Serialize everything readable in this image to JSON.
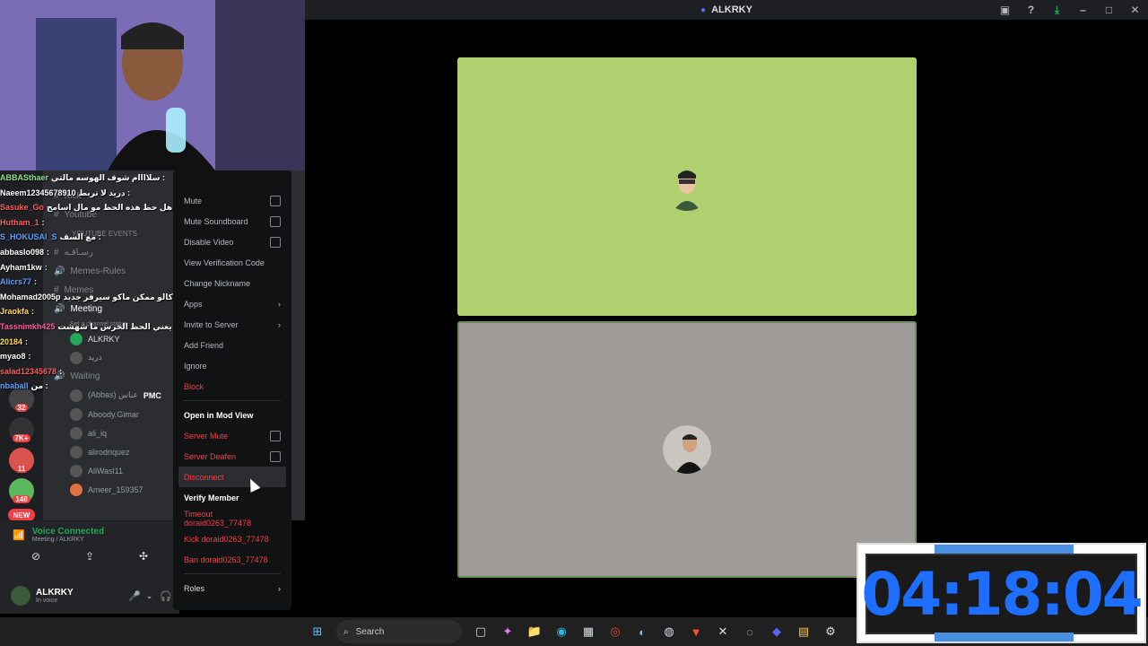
{
  "window": {
    "title": "ALKRKY"
  },
  "stage": {
    "tile_colors": [
      "#b0cf6f",
      "#9e9b98"
    ]
  },
  "chat": [
    {
      "user": "ABBASthaer",
      "text": "سلاااام شوف الهوسه مالتي :",
      "color": "#8be28b"
    },
    {
      "user": "Naeem12345678910",
      "text": "دريد لا تربط :",
      "color": "#ffffff"
    },
    {
      "user": "Sasuke_Go",
      "text": "ليش هل حظ هذه الحظ مو مال اسامح :",
      "color": "#ff5a5a"
    },
    {
      "user": "Hutham_1",
      "text": ":",
      "color": "#ff5a5a"
    },
    {
      "user": "S_HOKUSAI_S",
      "text": "مع السف :",
      "color": "#5aa0ff"
    },
    {
      "user": "abbaslo098",
      "text": ":",
      "color": "#ffffff"
    },
    {
      "user": "Ayham1kw",
      "text": ":",
      "color": "#ffffff"
    },
    {
      "user": "Alicrs77",
      "text": ":",
      "color": "#5aa0ff"
    },
    {
      "user": "Mohamad2005p",
      "text": "مو كم مرة كالو ممكن ماكو سيرفر جديد :",
      "color": "#ffffff"
    },
    {
      "user": "Jraokfa",
      "text": ":",
      "color": "#ffd75a"
    },
    {
      "user": "Tassnimkh425",
      "text": "كيف يعني الحظ الخرس ما شهشت :",
      "color": "#ff5aa5"
    },
    {
      "user": "20184",
      "text": ":",
      "color": "#ffd75a"
    },
    {
      "user": "myao8",
      "text": ":",
      "color": "#ffffff"
    },
    {
      "user": "salad12345678",
      "text": ":",
      "color": "#ff5a5a"
    },
    {
      "user": "nbaball",
      "text": "من :",
      "color": "#5aa0ff"
    }
  ],
  "channels": {
    "items": [
      "Kick",
      "Youtube",
      "YOUTUBE EVENTS",
      "رسـاقـه",
      "Memes-Rules",
      "Memes",
      "Meeting",
      "Set a channel status",
      "ALKRKY",
      "دريد",
      "Waiting"
    ],
    "members": [
      "(Abbas) عباس",
      "Aboody.Gimar",
      "ali_iq",
      "alirodriquez",
      "AliWasl11",
      "Ameer_159357"
    ],
    "member_tag": "PMC"
  },
  "rail_badges": [
    "32",
    "7K+",
    "11",
    "148",
    "NEW"
  ],
  "voice": {
    "status": "Voice Connected",
    "location": "Meeting / ALKRKY"
  },
  "user": {
    "name": "ALKRKY",
    "status": "In voice"
  },
  "menu": {
    "mute": "Mute",
    "mute_soundboard": "Mute Soundboard",
    "disable_video": "Disable Video",
    "view_code": "View Verification Code",
    "change_nick": "Change Nickname",
    "apps": "Apps",
    "invite": "Invite to Server",
    "add_friend": "Add Friend",
    "ignore": "Ignore",
    "block": "Block",
    "mod_view": "Open in Mod View",
    "server_mute": "Server Mute",
    "server_deafen": "Server Deafen",
    "disconnect": "Disconnect",
    "verify": "Verify Member",
    "timeout": "Timeout doraid0263_77478",
    "kick": "Kick doraid0263_77478",
    "ban": "Ban doraid0263_77478",
    "roles": "Roles"
  },
  "taskbar": {
    "search": "Search"
  },
  "timer": "04:18:04"
}
